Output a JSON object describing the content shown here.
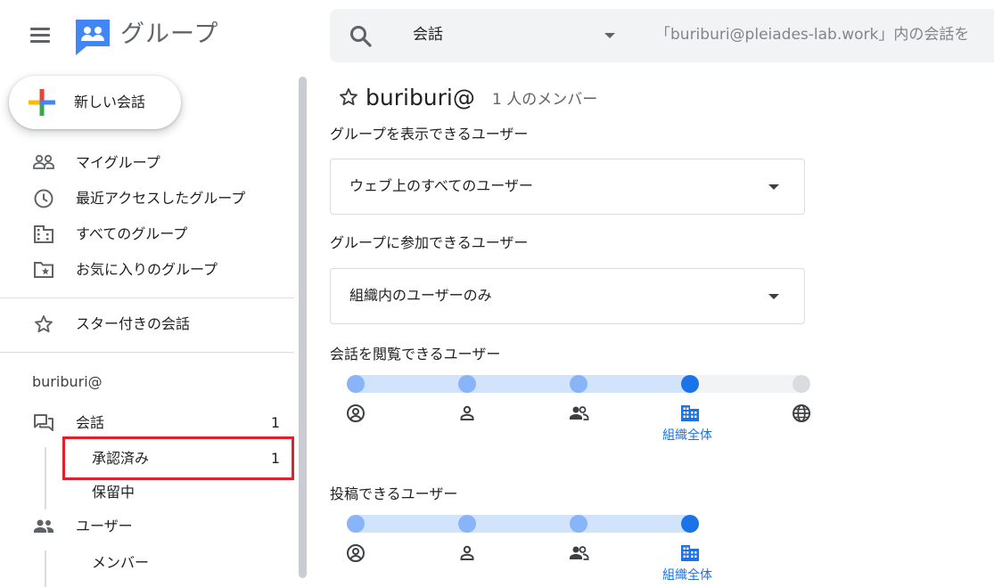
{
  "header": {
    "app_title": "グループ",
    "search_scope": "会話",
    "search_placeholder": "「buriburi@pleiades-lab.work」内の会話を"
  },
  "sidebar": {
    "new_conversation": "新しい会話",
    "nav": [
      {
        "label": "マイグループ",
        "icon": "people-outline-icon"
      },
      {
        "label": "最近アクセスしたグループ",
        "icon": "clock-icon"
      },
      {
        "label": "すべてのグループ",
        "icon": "building-icon"
      },
      {
        "label": "お気に入りのグループ",
        "icon": "star-folder-icon"
      }
    ],
    "starred": "スター付きの会話",
    "group_name": "buriburi@",
    "conversations": {
      "label": "会話",
      "count": "1"
    },
    "approved": {
      "label": "承認済み",
      "count": "1"
    },
    "pending": {
      "label": "保留中"
    },
    "users": {
      "label": "ユーザー"
    },
    "members": {
      "label": "メンバー"
    }
  },
  "main": {
    "group_title": "buriburi@",
    "member_count": "1 人のメンバー",
    "view_group": {
      "label": "グループを表示できるユーザー",
      "value": "ウェブ上のすべてのユーザー"
    },
    "join_group": {
      "label": "グループに参加できるユーザー",
      "value": "組織内のユーザーのみ"
    },
    "view_conversations": {
      "label": "会話を閲覧できるユーザー",
      "selected_level": 4,
      "levels": 5,
      "caption": "組織全体"
    },
    "post": {
      "label": "投稿できるユーザー",
      "selected_level": 4,
      "levels": 4,
      "caption": "組織全体"
    }
  },
  "colors": {
    "accent": "#1a73e8",
    "track_active": "#d2e3fc",
    "dot_active": "#8ab4f8",
    "track_inactive": "#f1f3f4",
    "dot_inactive": "#dadce0",
    "highlight": "#e0202a"
  }
}
